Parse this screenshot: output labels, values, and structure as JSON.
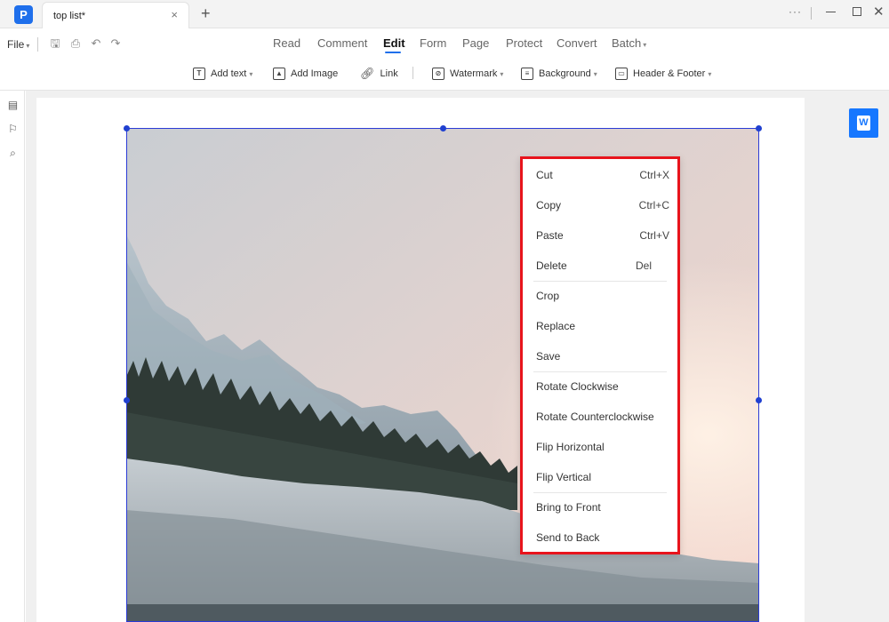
{
  "tab": {
    "title": "top list*",
    "close": "×",
    "new": "+"
  },
  "window": {
    "more": "···",
    "minimize": "",
    "maximize": "",
    "close": "✕"
  },
  "menu": {
    "file": "File",
    "tabs": [
      "Read",
      "Comment",
      "Edit",
      "Form",
      "Page",
      "Protect",
      "Convert",
      "Batch"
    ],
    "active_tab": "Edit"
  },
  "toolbar": {
    "add_text": "Add text",
    "add_image": "Add Image",
    "link": "Link",
    "watermark": "Watermark",
    "background": "Background",
    "header_footer": "Header & Footer"
  },
  "icons": {
    "app": "pdf-app-logo",
    "save": "save-icon",
    "print": "print-icon",
    "undo": "undo-icon",
    "redo": "redo-icon",
    "thumbnails": "page-thumbnails-icon",
    "bookmark": "bookmark-icon",
    "search": "search-icon",
    "word": "word-convert-icon"
  },
  "colors": {
    "accent": "#1f6feb",
    "menu_highlight_border": "#e8141c",
    "selection": "#2b3bd6"
  },
  "context_menu": {
    "cut": "Cut",
    "cut_shortcut": "Ctrl+X",
    "copy": "Copy",
    "copy_shortcut": "Ctrl+C",
    "paste": "Paste",
    "paste_shortcut": "Ctrl+V",
    "delete": "Delete",
    "delete_shortcut": "Del",
    "crop": "Crop",
    "replace": "Replace",
    "save": "Save",
    "rotate_cw": "Rotate Clockwise",
    "rotate_ccw": "Rotate Counterclockwise",
    "flip_h": "Flip Horizontal",
    "flip_v": "Flip Vertical",
    "bring_front": "Bring to Front",
    "send_back": "Send to Back"
  }
}
